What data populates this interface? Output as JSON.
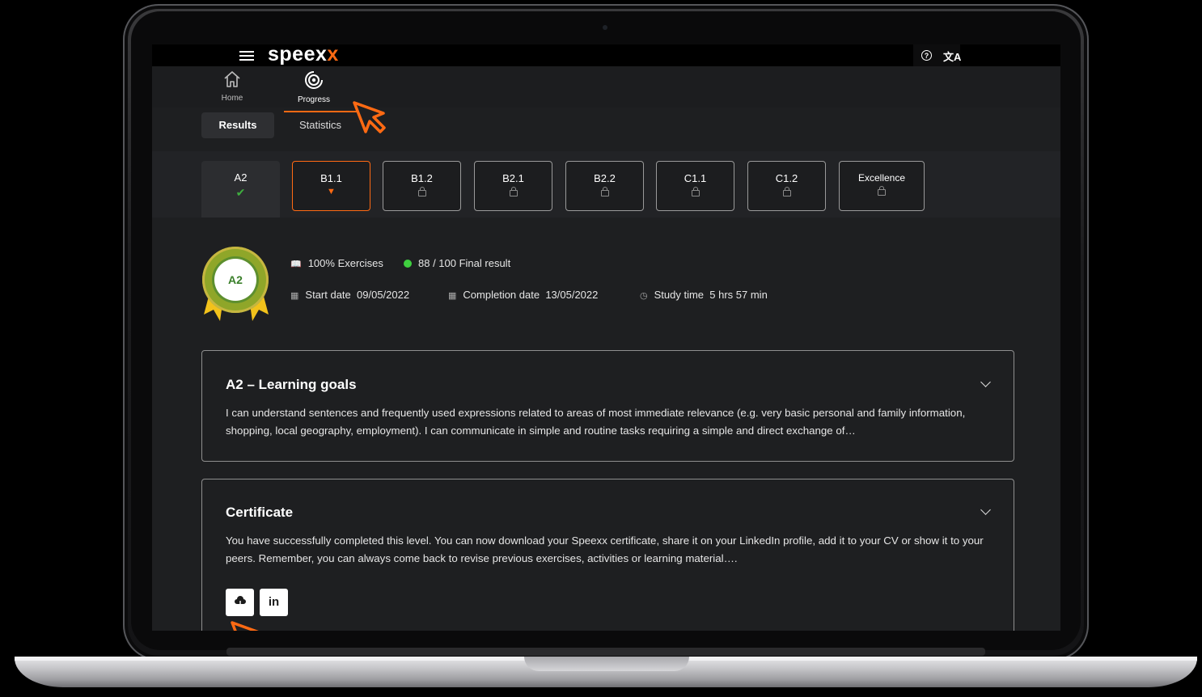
{
  "app": {
    "logo_main": "speex",
    "logo_accent": "x",
    "help_icon": "help-icon",
    "translate_icon": "translate-icon"
  },
  "nav": {
    "items": [
      {
        "label": "Home",
        "icon": "home-icon"
      },
      {
        "label": "Progress",
        "icon": "progress-icon"
      }
    ]
  },
  "tabs": {
    "results": "Results",
    "statistics": "Statistics"
  },
  "levels": [
    {
      "name": "A2",
      "status": "completed"
    },
    {
      "name": "B1.1",
      "status": "current"
    },
    {
      "name": "B1.2",
      "status": "locked"
    },
    {
      "name": "B2.1",
      "status": "locked"
    },
    {
      "name": "B2.2",
      "status": "locked"
    },
    {
      "name": "C1.1",
      "status": "locked"
    },
    {
      "name": "C1.2",
      "status": "locked"
    },
    {
      "name": "Excellence",
      "status": "locked"
    }
  ],
  "summary": {
    "badge_level": "A2",
    "exercises": "100% Exercises",
    "final_result": "88 / 100 Final result",
    "start_label": "Start date",
    "start_value": "09/05/2022",
    "completion_label": "Completion date",
    "completion_value": "13/05/2022",
    "study_label": "Study time",
    "study_value": "5 hrs 57 min"
  },
  "goals_card": {
    "title": "A2 – Learning goals",
    "text": "I can understand sentences and frequently used expressions related to areas of most immediate relevance (e.g. very basic personal and family information, shopping, local geography, employment). I can communicate in simple and routine tasks requiring a simple and direct exchange of…"
  },
  "certificate_card": {
    "title": "Certificate",
    "text": "You have successfully completed this level. You can now download your Speexx certificate, share it on your LinkedIn profile, add it to your CV or show it to your peers. Remember, you can always come back to revise previous exercises, activities or learning material….",
    "download_icon": "cloud-download-icon",
    "linkedin_label": "in"
  },
  "colors": {
    "accent": "#ff6a13",
    "success": "#3fcf3f",
    "background": "#1e1f21"
  }
}
